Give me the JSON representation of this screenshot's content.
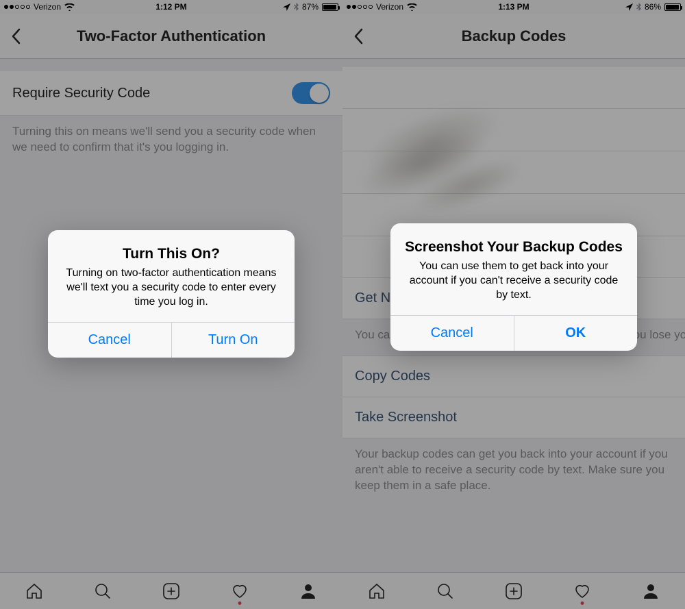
{
  "left": {
    "status": {
      "carrier": "Verizon",
      "time": "1:12 PM",
      "battery_pct": "87%",
      "battery_fill": 87
    },
    "nav": {
      "title": "Two-Factor Authentication"
    },
    "setting": {
      "label": "Require Security Code",
      "help": "Turning this on means we'll send you a security code when we need to confirm that it's you logging in."
    },
    "alert": {
      "title": "Turn This On?",
      "text": "Turning on two-factor authentication means we'll text you a security code to enter every time you log in.",
      "cancel": "Cancel",
      "confirm": "Turn On"
    }
  },
  "right": {
    "status": {
      "carrier": "Verizon",
      "time": "1:13 PM",
      "battery_pct": "86%",
      "battery_fill": 86
    },
    "nav": {
      "title": "Backup Codes"
    },
    "rows": {
      "get_new": "Get New Codes",
      "help1": "You can use these if your phone number changes or you lose your phone.",
      "copy": "Copy Codes",
      "screenshot": "Take Screenshot",
      "help2": "Your backup codes can get you back into your account if you aren't able to receive a security code by text. Make sure you keep them in a safe place."
    },
    "alert": {
      "title": "Screenshot Your Backup Codes",
      "text": "You can use them to get back into your account if you can't receive a security code by text.",
      "cancel": "Cancel",
      "confirm": "OK"
    }
  },
  "icons": {
    "home": "home-icon",
    "search": "search-icon",
    "add": "add-icon",
    "activity": "heart-icon",
    "profile": "profile-icon"
  }
}
